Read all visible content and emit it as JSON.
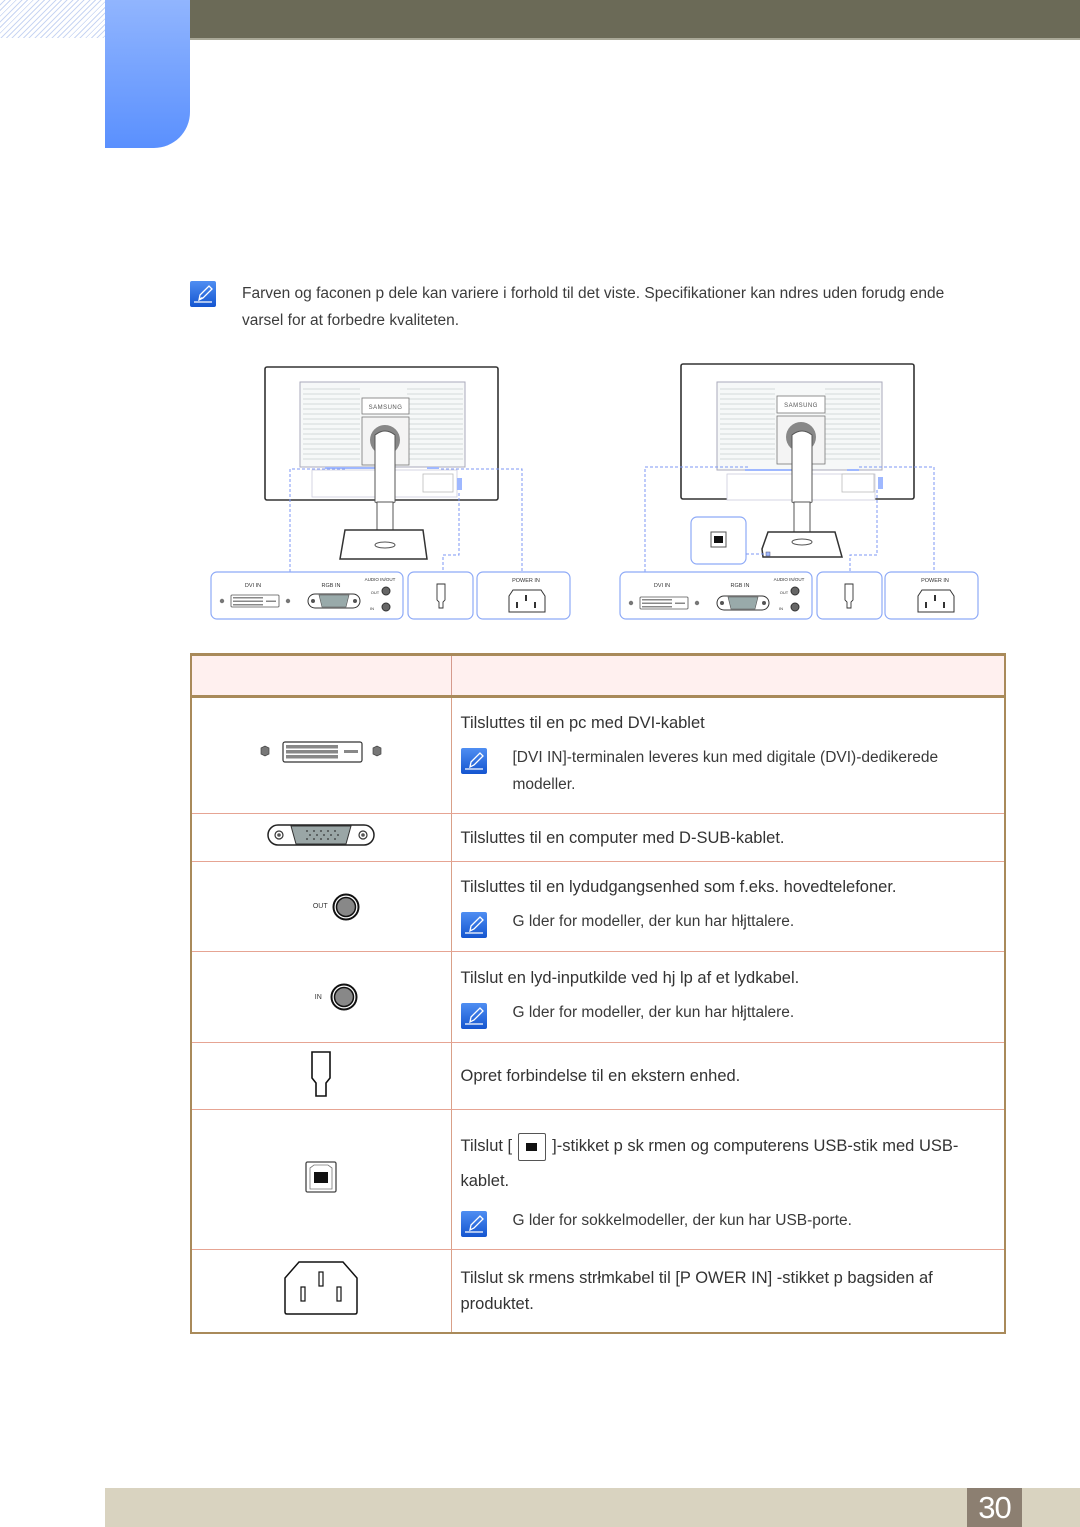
{
  "header": {
    "accent_color": "#5a90fe",
    "bar_color": "#6b6a57"
  },
  "intro_note": {
    "icon": "note-pencil-icon",
    "text": "Farven og faconen p  dele kan variere i forhold til det viste. Specifikationer kan  ndres uden forudg ende varsel for at forbedre kvaliteten."
  },
  "diagrams": [
    {
      "name": "monitor-back-standard",
      "brand": "SAMSUNG",
      "panels": {
        "dvi": "DVI IN",
        "rgb": "RGB IN",
        "audio": "AUDIO IN/OUT",
        "audio_out": "OUT",
        "audio_in": "IN",
        "power": "POWER IN"
      }
    },
    {
      "name": "monitor-back-usb",
      "brand": "SAMSUNG",
      "panels": {
        "dvi": "DVI IN",
        "rgb": "RGB IN",
        "audio": "AUDIO IN/OUT",
        "audio_out": "OUT",
        "audio_in": "IN",
        "power": "POWER IN"
      }
    }
  ],
  "table": {
    "headers": [
      "",
      ""
    ],
    "rows": [
      {
        "port_icon": "dvi-port-icon",
        "description": "Tilsluttes til en pc med DVI-kablet",
        "note": "[DVI IN]-terminalen leveres kun med digitale (DVI)-dedikerede modeller."
      },
      {
        "port_icon": "dsub-port-icon",
        "description": "Tilsluttes til en computer med D-SUB-kablet."
      },
      {
        "port_icon": "audio-out-jack-icon",
        "port_label": "OUT",
        "description": "Tilsluttes til en lydudgangsenhed som f.eks. hovedtelefoner.",
        "note": "G lder for modeller, der kun har hłjttalere."
      },
      {
        "port_icon": "audio-in-jack-icon",
        "port_label": "IN",
        "description": "Tilslut en lyd-inputkilde ved hj lp af et lydkabel.",
        "note": "G lder for modeller, der kun har hłjttalere."
      },
      {
        "port_icon": "kensington-lock-icon",
        "description": "Opret forbindelse til en ekstern enhed."
      },
      {
        "port_icon": "usb-b-port-icon",
        "description_before": "Tilslut [",
        "description_after": "]-stikket p  sk rmen og computerens USB-stik med USB-kablet.",
        "note": "G lder for sokkelmodeller, der kun har USB-porte."
      },
      {
        "port_icon": "power-in-socket-icon",
        "description": "Tilslut sk rmens strłmkabel til [P OWER IN] -stikket p  bagsiden af produktet."
      }
    ]
  },
  "footer": {
    "page_number": "30"
  }
}
